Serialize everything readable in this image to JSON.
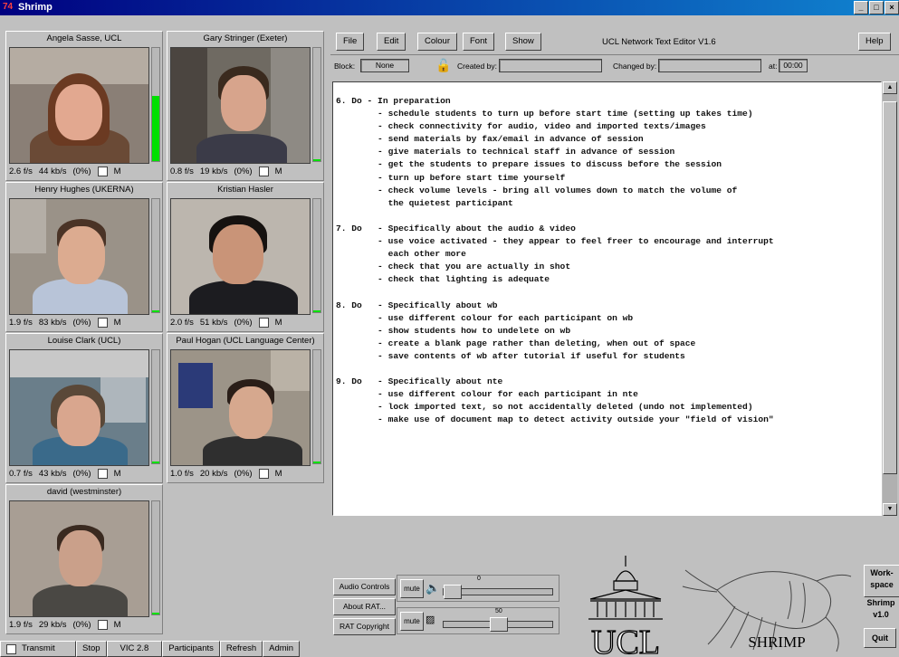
{
  "window": {
    "title": "Shrimp",
    "app_icon": "rat-icon"
  },
  "participants": [
    {
      "name": "Angela  Sasse, UCL",
      "fps": "2.6 f/s",
      "kbps": "44 kb/s",
      "loss": "(0%)",
      "m": "M",
      "level": 0.58
    },
    {
      "name": "Gary Stringer (Exeter)",
      "fps": "0.8 f/s",
      "kbps": "19 kb/s",
      "loss": "(0%)",
      "m": "M",
      "level": 0.02
    },
    {
      "name": "Henry Hughes (UKERNA)",
      "fps": "1.9 f/s",
      "kbps": "83 kb/s",
      "loss": "(0%)",
      "m": "M",
      "level": 0.02
    },
    {
      "name": "Kristian Hasler",
      "fps": "2.0 f/s",
      "kbps": "51 kb/s",
      "loss": "(0%)",
      "m": "M",
      "level": 0.02
    },
    {
      "name": "Louise Clark (UCL)",
      "fps": "0.7 f/s",
      "kbps": "43 kb/s",
      "loss": "(0%)",
      "m": "M",
      "level": 0.02
    },
    {
      "name": "Paul Hogan (UCL Language Center)",
      "fps": "1.0 f/s",
      "kbps": "20 kb/s",
      "loss": "(0%)",
      "m": "M",
      "level": 0.02
    },
    {
      "name": "david (westminster)",
      "fps": "1.9 f/s",
      "kbps": "29 kb/s",
      "loss": "(0%)",
      "m": "M",
      "level": 0.02
    }
  ],
  "bottom_bar": {
    "transmit": "Transmit",
    "stop": "Stop",
    "version": "VIC 2.8",
    "participants": "Participants",
    "refresh": "Refresh",
    "admin": "Admin"
  },
  "editor": {
    "menu": {
      "file": "File",
      "edit": "Edit",
      "colour": "Colour",
      "font": "Font",
      "show": "Show",
      "help": "Help"
    },
    "title": "UCL Network Text Editor V1.6",
    "info": {
      "block_label": "Block:",
      "block_value": "None",
      "created_label": "Created by:",
      "created_value": "",
      "changed_label": "Changed by:",
      "changed_value": "",
      "at_label": "at:",
      "at_value": "00:00"
    },
    "text": "6. Do - In preparation\n        - schedule students to turn up before start time (setting up takes time)\n        - check connectivity for audio, video and imported texts/images\n        - send materials by fax/email in advance of session\n        - give materials to technical staff in advance of session\n        - get the students to prepare issues to discuss before the session\n        - turn up before start time yourself\n        - check volume levels - bring all volumes down to match the volume of\n          the quietest participant\n\n7. Do   - Specifically about the audio & video\n        - use voice activated - they appear to feel freer to encourage and interrupt\n          each other more\n        - check that you are actually in shot\n        - check that lighting is adequate\n\n8. Do   - Specifically about wb\n        - use different colour for each participant on wb\n        - show students how to undelete on wb\n        - create a blank page rather than deleting, when out of space\n        - save contents of wb after tutorial if useful for students\n\n9. Do   - Specifically about nte\n        - use different colour for each participant in nte\n        - lock imported text, so not accidentally deleted (undo not implemented)\n        - make use of document map to detect activity outside your \"field of vision\""
  },
  "rat": {
    "audio_controls": "Audio Controls",
    "about": "About RAT...",
    "copyright": "RAT Copyright",
    "mute1": "mute",
    "mute2": "mute",
    "speaker_value": "0",
    "mic_value": "50",
    "speaker_level": 0.0,
    "mic_level": 0.5
  },
  "logos": {
    "ucl": "UCL",
    "shrimp": "SHRIMP"
  },
  "side": {
    "workspace": "Work-\nspace",
    "version": "Shrimp\nv1.0",
    "quit": "Quit"
  }
}
